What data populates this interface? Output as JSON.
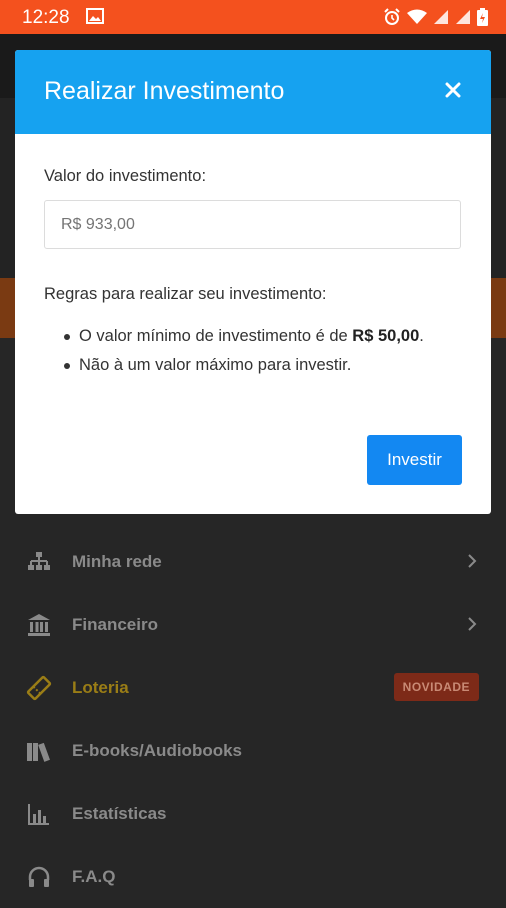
{
  "status_bar": {
    "time": "12:28"
  },
  "modal": {
    "title": "Realizar Investimento",
    "field_label": "Valor do investimento:",
    "field_placeholder": "R$ 933,00",
    "rules_title": "Regras para realizar seu investimento:",
    "rule1_prefix": "O valor mínimo de investimento é de ",
    "rule1_value": "R$ 50,00",
    "rule1_suffix": ".",
    "rule2": "Não à um valor máximo para investir.",
    "submit_label": "Investir"
  },
  "menu": {
    "items": [
      {
        "label": "Minha rede",
        "icon": "network-icon"
      },
      {
        "label": "Financeiro",
        "icon": "bank-icon"
      },
      {
        "label": "Loteria",
        "icon": "ticket-icon",
        "badge": "NOVIDADE"
      },
      {
        "label": "E-books/Audiobooks",
        "icon": "books-icon"
      },
      {
        "label": "Estatísticas",
        "icon": "stats-icon"
      },
      {
        "label": "F.A.Q",
        "icon": "headset-icon"
      }
    ]
  },
  "colors": {
    "status_bar": "#f4511e",
    "modal_header": "#16a2f0",
    "primary_button": "#1388f2",
    "menu_active": "#9a7d16",
    "badge_bg": "#7d2a18"
  }
}
